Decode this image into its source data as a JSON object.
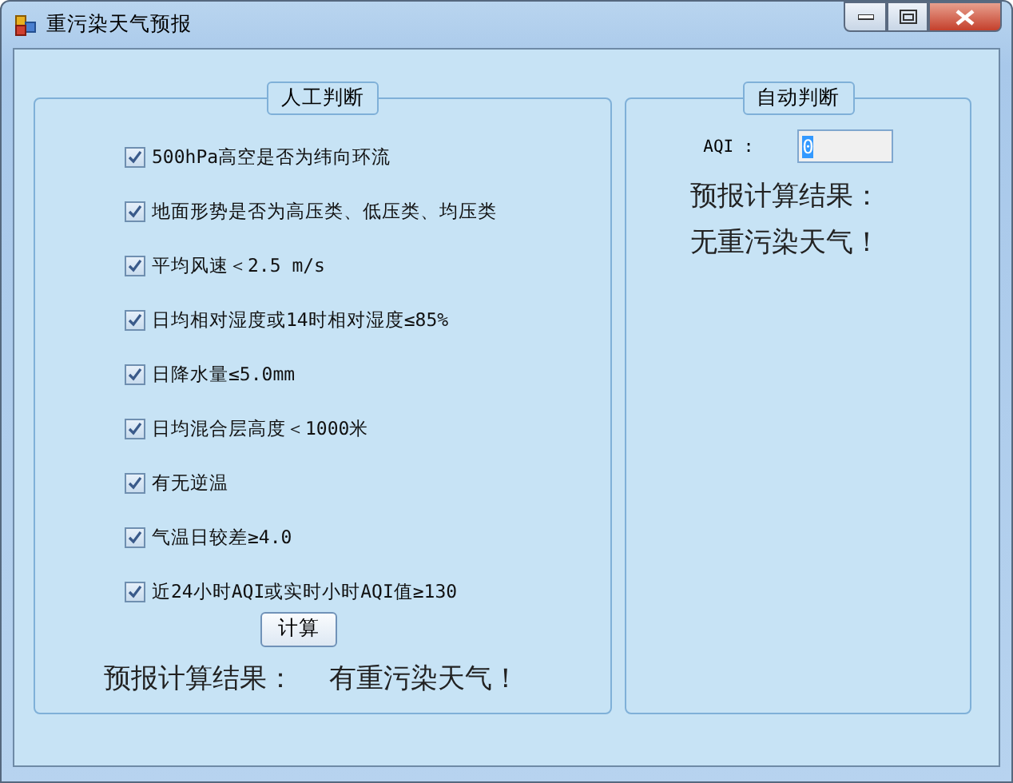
{
  "window": {
    "title": "重污染天气预报"
  },
  "manual_group": {
    "title": "人工判断",
    "criteria": [
      {
        "label": "500hPa高空是否为纬向环流",
        "checked": true
      },
      {
        "label": "地面形势是否为高压类、低压类、均压类",
        "checked": true
      },
      {
        "label": "平均风速＜2.5 m/s",
        "checked": true
      },
      {
        "label": "日均相对湿度或14时相对湿度≤85%",
        "checked": true
      },
      {
        "label": "日降水量≤5.0mm",
        "checked": true
      },
      {
        "label": "日均混合层高度＜1000米",
        "checked": true
      },
      {
        "label": "有无逆温",
        "checked": true
      },
      {
        "label": "气温日较差≥4.0",
        "checked": true
      },
      {
        "label": "近24小时AQI或实时小时AQI值≥130",
        "checked": true
      }
    ],
    "button": "计算",
    "result_label": "预报计算结果：",
    "result_value": "有重污染天气！"
  },
  "auto_group": {
    "title": "自动判断",
    "aqi_label": "AQI :",
    "aqi_value": "0",
    "result_label": "预报计算结果：",
    "result_value": "无重污染天气！"
  }
}
